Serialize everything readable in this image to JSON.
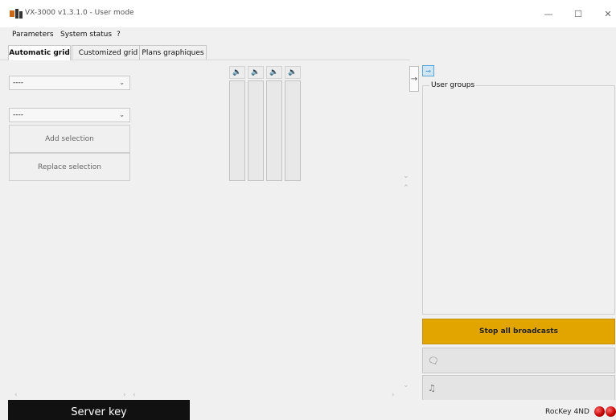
{
  "window": {
    "title": "VX-3000 v1.3.1.0 - User mode",
    "minimize": "—",
    "maximize": "☐",
    "close": "✕"
  },
  "menu": [
    "Parameters",
    "System status",
    "?"
  ],
  "tabs": [
    "Automatic grid",
    "Customized grid",
    "Plans graphiques"
  ],
  "left": {
    "combo1_value": "----",
    "combo2_value": "----",
    "add_selection": "Add selection",
    "replace_selection": "Replace selection"
  },
  "speakers": {
    "count": 4,
    "icon": "speaker-icon"
  },
  "right_panel": {
    "pin_icon": "pin-icon",
    "user_groups_title": "User groups",
    "stop_all": "Stop all broadcasts",
    "message_icon": "message-icon",
    "music_icon": "music-icon"
  },
  "status": {
    "server_key": "Server key",
    "rockey": "RocKey 4ND",
    "led_color": "#c00000"
  },
  "colors": {
    "accent": "#e2a500",
    "pin_blue": "#5aa3d8"
  }
}
